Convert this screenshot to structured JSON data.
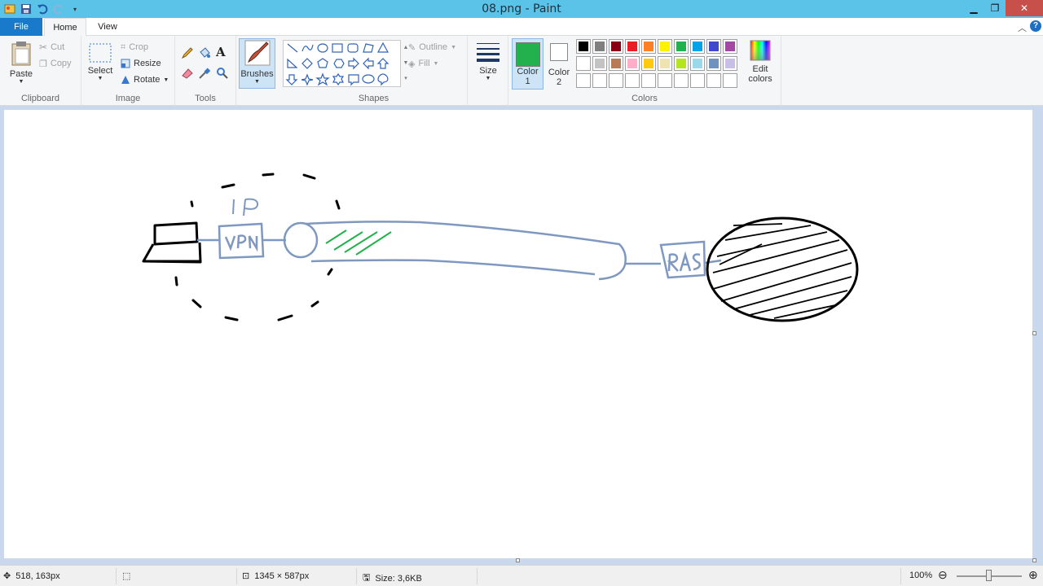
{
  "window": {
    "title": "08.png - Paint"
  },
  "tabs": {
    "file": "File",
    "home": "Home",
    "view": "View"
  },
  "clipboard": {
    "paste": "Paste",
    "cut": "Cut",
    "copy": "Copy",
    "label": "Clipboard"
  },
  "image": {
    "select": "Select",
    "crop": "Crop",
    "resize": "Resize",
    "rotate": "Rotate",
    "label": "Image"
  },
  "tools": {
    "label": "Tools"
  },
  "brushes": {
    "label": "Brushes"
  },
  "shapes": {
    "label": "Shapes",
    "outline": "Outline",
    "fill": "Fill"
  },
  "size": {
    "label": "Size"
  },
  "colors": {
    "color1_label": "Color",
    "color1_num": "1",
    "color2_label": "Color",
    "color2_num": "2",
    "color1_value": "#22b14c",
    "color2_value": "#ffffff",
    "edit1": "Edit",
    "edit2": "colors",
    "label": "Colors",
    "palette_row1": [
      "#000000",
      "#7f7f7f",
      "#880015",
      "#ed1c24",
      "#ff7f27",
      "#fff200",
      "#22b14c",
      "#00a2e8",
      "#3f48cc",
      "#a349a4"
    ],
    "palette_row2": [
      "#ffffff",
      "#c3c3c3",
      "#b97a57",
      "#ffaec9",
      "#ffc90e",
      "#efe4b0",
      "#b5e61d",
      "#99d9ea",
      "#7092be",
      "#c8bfe7"
    ]
  },
  "drawing": {
    "ip": "IP",
    "vpn": "VPN",
    "ras": "RAS"
  },
  "status": {
    "cursor": "518, 163px",
    "dimensions": "1345 × 587px",
    "size": "Size: 3,6KB",
    "zoom": "100%",
    "zoom_fraction": 0.5
  }
}
